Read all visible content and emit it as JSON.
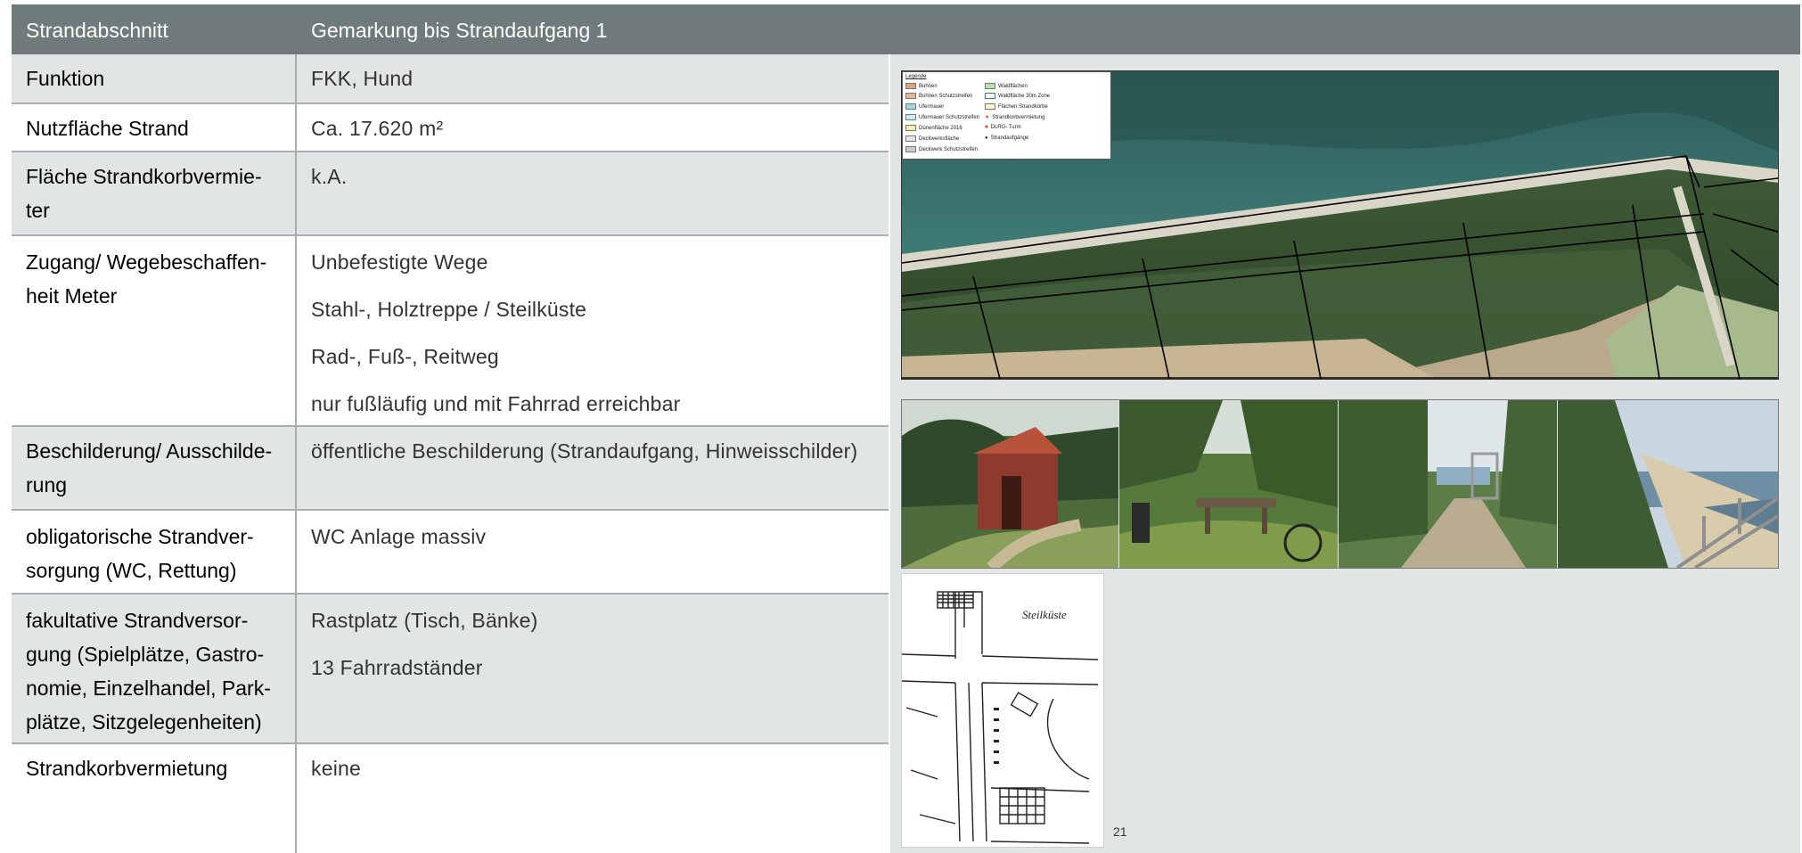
{
  "header": {
    "col1": "Strandabschnitt",
    "col2": "Gemarkung bis Strandaufgang 1"
  },
  "rows": [
    {
      "label": "Funktion",
      "values": [
        "FKK, Hund"
      ]
    },
    {
      "label": "Nutzfläche Strand",
      "values": [
        "Ca. 17.620 m²"
      ]
    },
    {
      "label": "Fläche Strandkorbvermie-ter",
      "values": [
        "k.A."
      ]
    },
    {
      "label": "Zugang/ Wegebeschaffen-heit Meter",
      "values": [
        "Unbefestigte Wege",
        "Stahl-, Holztreppe / Steilküste",
        "Rad-, Fuß-, Reitweg",
        "nur fußläufig und mit Fahrrad erreichbar"
      ]
    },
    {
      "label": "Beschilderung/ Ausschilde-rung",
      "values": [
        "öffentliche Beschilderung (Strandaufgang, Hinweisschilder)"
      ]
    },
    {
      "label": "obligatorische Strandver-sorgung (WC, Rettung)",
      "values": [
        "WC Anlage massiv"
      ]
    },
    {
      "label": "fakultative Strandversor-gung (Spielplätze, Gastro-nomie, Einzelhandel, Park-plätze, Sitzgelegenheiten)",
      "values": [
        "Rastplatz (Tisch, Bänke)",
        "13 Fahrradständer"
      ]
    },
    {
      "label": "Strandkorbvermietung",
      "values": [
        "keine"
      ]
    }
  ],
  "legend": {
    "title": "Legende",
    "items": [
      {
        "label": "Buhnen",
        "color": "#d9a77a"
      },
      {
        "label": "Buhnen Schutzstreifen",
        "color": "#e8b98e"
      },
      {
        "label": "Ufermauer",
        "color": "#9fd8e0"
      },
      {
        "label": "Ufermauer Schutzstreifen",
        "color": "#c9eef2"
      },
      {
        "label": "Dünenfläche 2016",
        "color": "#f4f1a8"
      },
      {
        "label": "Deckwerksfläche",
        "color": "#e6e6e6"
      },
      {
        "label": "Deckwerk Schutzstreifen",
        "color": "#cccccc"
      },
      {
        "label": "Waldflächen",
        "color": "#b9e3a6"
      },
      {
        "label": "Waldfläche 30m Zone",
        "color": "#ffffff"
      },
      {
        "label": "Flächen Strandkörbe",
        "color": "#fff7d0"
      },
      {
        "label": "Strandkorbvermietung",
        "color": "#e74c3c"
      },
      {
        "label": "DLRG- Turm",
        "color": "#e74c3c"
      },
      {
        "label": "Strandaufgänge",
        "color": "#222222"
      }
    ]
  },
  "sketch_text": "Steilküste",
  "page_number": "21"
}
